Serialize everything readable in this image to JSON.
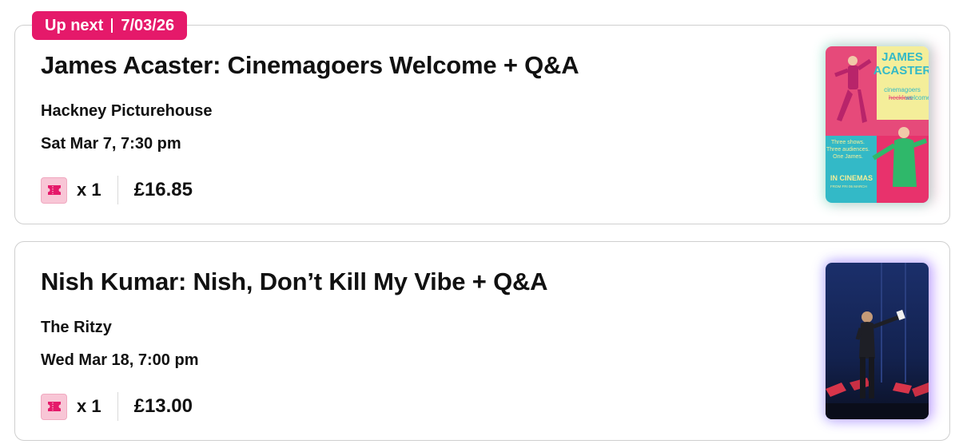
{
  "bookings": [
    {
      "badge": {
        "label": "Up next",
        "date": "7/03/26"
      },
      "title": "James Acaster: Cinemagoers Welcome + Q&A",
      "venue": "Hackney Picturehouse",
      "datetime": "Sat Mar 7, 7:30 pm",
      "quantity": "x 1",
      "price": "£16.85",
      "poster": {
        "name_line1": "JAMES",
        "name_line2": "ACASTER",
        "sub_line1": "cinemagoers",
        "sub_struck": "hecklers",
        "sub_line2": "welcome",
        "tag_line1": "Three shows.",
        "tag_line2": "Three audiences.",
        "tag_line3": "One James.",
        "release_line1": "IN CINEMAS",
        "release_line2": "FROM FRI 06 MARCH"
      }
    },
    {
      "title": "Nish Kumar: Nish, Don’t Kill My Vibe + Q&A",
      "venue": "The Ritzy",
      "datetime": "Wed Mar 18, 7:00 pm",
      "quantity": "x 1",
      "price": "£13.00"
    }
  ],
  "colors": {
    "brand": "#e5196a",
    "ticket_icon_bg": "#f8c6d6",
    "card_border": "#cfcfcf"
  },
  "icons": {
    "ticket": "ticket-icon"
  }
}
